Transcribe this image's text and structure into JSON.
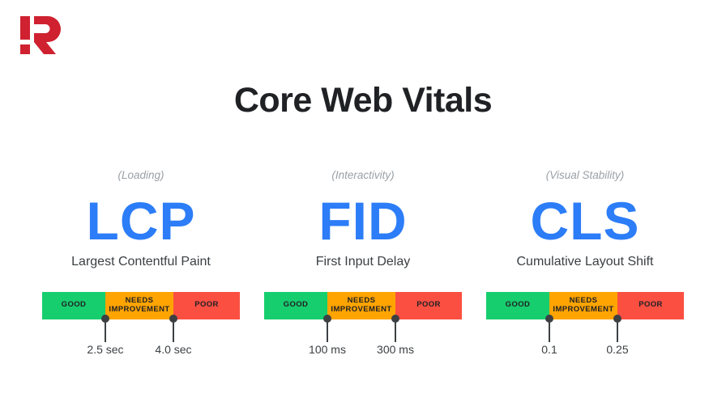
{
  "brand": {
    "logo_name": "exclamation-r-logo",
    "logo_color": "#cf2130"
  },
  "header": {
    "title": "Core Web Vitals"
  },
  "theme": {
    "background": "#ffffff",
    "title_color": "#202124",
    "acronym_color": "#2c7df7",
    "category_color": "#9aa0a6",
    "fullname_color": "#3c4043",
    "good_color": "#17ce6f",
    "needs_improvement_color": "#ffa400",
    "poor_color": "#fb4f42",
    "marker_color": "#3c4043"
  },
  "bar_labels": {
    "good": "GOOD",
    "needs_improvement_line1": "NEEDS",
    "needs_improvement_line2": "IMPROVEMENT",
    "poor": "POOR"
  },
  "metrics": [
    {
      "category": "(Loading)",
      "acronym": "LCP",
      "fullname": "Largest Contentful Paint",
      "threshold_good_max": "2.5 sec",
      "threshold_poor_min": "4.0 sec"
    },
    {
      "category": "(Interactivity)",
      "acronym": "FID",
      "fullname": "First Input Delay",
      "threshold_good_max": "100 ms",
      "threshold_poor_min": "300 ms"
    },
    {
      "category": "(Visual Stability)",
      "acronym": "CLS",
      "fullname": "Cumulative Layout Shift",
      "threshold_good_max": "0.1",
      "threshold_poor_min": "0.25"
    }
  ]
}
